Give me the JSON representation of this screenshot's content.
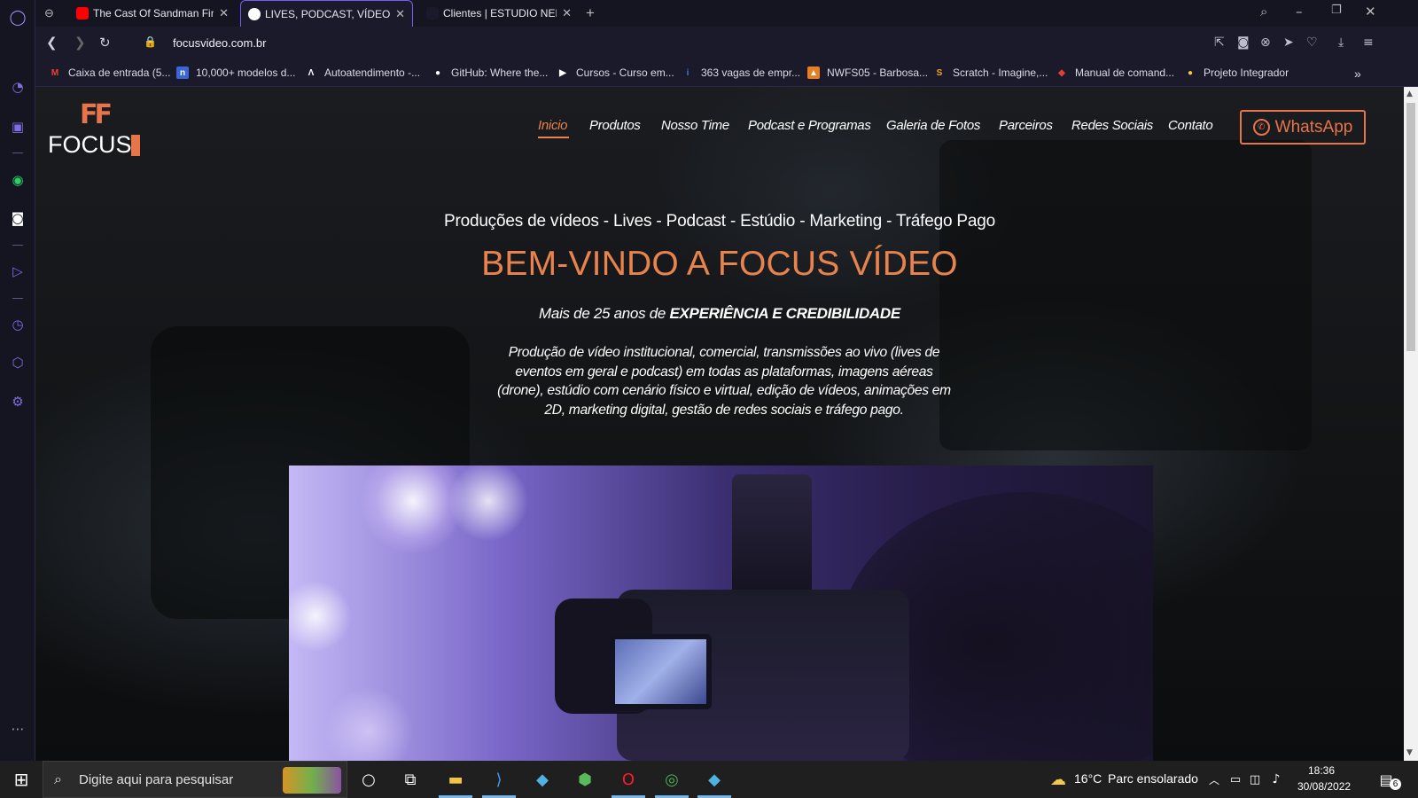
{
  "browser": {
    "tabs": [
      {
        "title": "The Cast Of Sandman Find",
        "favicon_color": "#ff0000",
        "active": false
      },
      {
        "title": "LIVES, PODCAST, VÍDEOS, E",
        "favicon_color": "#ffffff",
        "active": true
      },
      {
        "title": "Clientes | ESTUDIO NEKTAR",
        "favicon_color": "#1b1a2b",
        "active": false
      }
    ],
    "new_tab": "+",
    "close_glyph": "✕",
    "address": "focusvideo.com.br",
    "bookmarks": [
      {
        "label": "Caixa de entrada (5...",
        "icon": "gmail-icon",
        "color": "#ea4335",
        "glyph": "M"
      },
      {
        "label": "10,000+ modelos d...",
        "icon": "nicepage-icon",
        "color": "#3a66d8",
        "glyph": "n"
      },
      {
        "label": "Autoatendimento -...",
        "icon": "lambda-icon",
        "color": "#1b1a2b",
        "glyph": "Λ"
      },
      {
        "label": "GitHub: Where the...",
        "icon": "github-icon",
        "color": "#1b1a2b",
        "glyph": "●"
      },
      {
        "label": "Cursos - Curso em...",
        "icon": "youtube-icon",
        "color": "#1b1a2b",
        "glyph": "▶"
      },
      {
        "label": "363 vagas de empr...",
        "icon": "indeed-icon",
        "color": "#1b1a2b",
        "glyph": "i"
      },
      {
        "label": "NWFS05 - Barbosa...",
        "icon": "profile-icon",
        "color": "#e67e22",
        "glyph": "▲"
      },
      {
        "label": "Scratch - Imagine,...",
        "icon": "scratch-icon",
        "color": "#f5a623",
        "glyph": "S"
      },
      {
        "label": "Manual de comand...",
        "icon": "git-icon",
        "color": "#e2402c",
        "glyph": "◆"
      },
      {
        "label": "Projeto Integrador",
        "icon": "pi-icon",
        "color": "#f5c842",
        "glyph": "●"
      }
    ],
    "more": "»"
  },
  "site": {
    "logo_text": "FOCUS",
    "logo_mark": "FF",
    "menu": [
      "Inicio",
      "Produtos",
      "Nosso Time",
      "Podcast e Programas",
      "Galeria de Fotos",
      "Parceiros",
      "Redes Sociais",
      "Contato"
    ],
    "whatsapp_label": "WhatsApp",
    "services": "Produções de vídeos - Lives - Podcast - Estúdio - Marketing - Tráfego Pago",
    "headline": "BEM-VINDO A FOCUS VÍDEO",
    "experience_prefix": "Mais de 25 anos de ",
    "experience_bold": "EXPERIÊNCIA E CREDIBILIDADE",
    "description": "Produção de vídeo institucional, comercial, transmissões ao vivo (lives de eventos em geral e podcast) em todas as plataformas,  imagens aéreas (drone), estúdio com cenário físico e virtual, edição de vídeos, animações em 2D, marketing digital, gestão de redes sociais e tráfego pago.",
    "accent_color": "#e8834e"
  },
  "taskbar": {
    "search_placeholder": "Digite aqui para pesquisar",
    "weather_temp": "16°C",
    "weather_text": "Parc ensolarado",
    "time": "18:36",
    "date": "30/08/2022",
    "notifications": "6"
  }
}
